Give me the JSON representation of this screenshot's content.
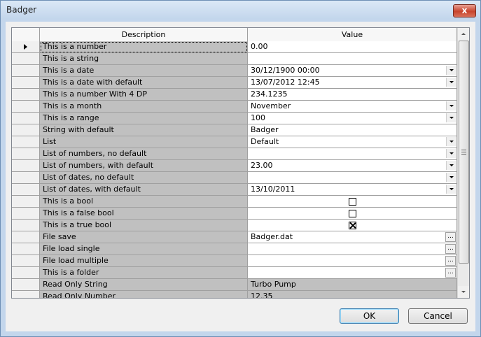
{
  "window": {
    "title": "Badger",
    "close_glyph": "x"
  },
  "grid": {
    "headers": {
      "description": "Description",
      "value": "Value"
    },
    "rows": [
      {
        "description": "This is a number",
        "value": "0.00",
        "editor": "text"
      },
      {
        "description": "This is a string",
        "value": "",
        "editor": "text"
      },
      {
        "description": "This is a date",
        "value": "30/12/1900 00:00",
        "editor": "dropdown"
      },
      {
        "description": "This is a date with default",
        "value": "13/07/2012 12:45",
        "editor": "dropdown"
      },
      {
        "description": "This is a number With 4 DP",
        "value": "234.1235",
        "editor": "text"
      },
      {
        "description": "This is a month",
        "value": "November",
        "editor": "dropdown"
      },
      {
        "description": "This is a range",
        "value": "100",
        "editor": "dropdown"
      },
      {
        "description": "String with default",
        "value": "Badger",
        "editor": "text"
      },
      {
        "description": "List",
        "value": "Default",
        "editor": "dropdown"
      },
      {
        "description": "List of numbers, no default",
        "value": "",
        "editor": "dropdown"
      },
      {
        "description": "List of numbers, with default",
        "value": "23.00",
        "editor": "dropdown"
      },
      {
        "description": "List of dates, no default",
        "value": "",
        "editor": "dropdown"
      },
      {
        "description": "List of dates, with default",
        "value": "13/10/2011",
        "editor": "dropdown"
      },
      {
        "description": "This is a bool",
        "value": "",
        "editor": "checkbox",
        "checked": false
      },
      {
        "description": "This is a false bool",
        "value": "",
        "editor": "checkbox",
        "checked": false
      },
      {
        "description": "This is a true bool",
        "value": "",
        "editor": "checkbox",
        "checked": true
      },
      {
        "description": "File save",
        "value": "Badger.dat",
        "editor": "ellipsis"
      },
      {
        "description": "File load single",
        "value": "",
        "editor": "ellipsis"
      },
      {
        "description": "File load multiple",
        "value": "",
        "editor": "ellipsis"
      },
      {
        "description": "This is a folder",
        "value": "",
        "editor": "ellipsis"
      },
      {
        "description": "Read Only String",
        "value": "Turbo Pump",
        "editor": "readonly"
      },
      {
        "description": "Read Only Number",
        "value": "12.35",
        "editor": "readonly"
      }
    ],
    "ellipsis_label": "...",
    "current_row": 0
  },
  "buttons": {
    "ok": "OK",
    "cancel": "Cancel"
  }
}
